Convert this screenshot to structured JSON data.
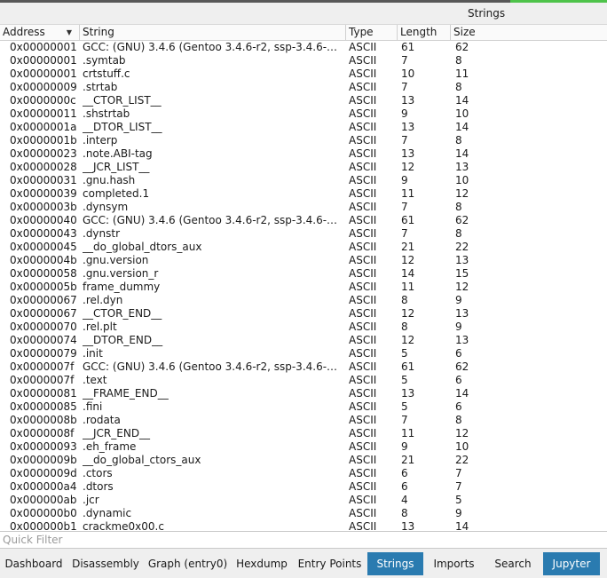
{
  "panel": {
    "title": "Strings"
  },
  "table": {
    "columns": {
      "address": "Address",
      "string": "String",
      "type": "Type",
      "length": "Length",
      "size": "Size"
    },
    "rows": [
      [
        "0x00000001",
        "GCC: (GNU) 3.4.6 (Gentoo 3.4.6-r2, ssp-3.4.6-…",
        "ASCII",
        "61",
        "62"
      ],
      [
        "0x00000001",
        ".symtab",
        "ASCII",
        "7",
        "8"
      ],
      [
        "0x00000001",
        "crtstuff.c",
        "ASCII",
        "10",
        "11"
      ],
      [
        "0x00000009",
        ".strtab",
        "ASCII",
        "7",
        "8"
      ],
      [
        "0x0000000c",
        "__CTOR_LIST__",
        "ASCII",
        "13",
        "14"
      ],
      [
        "0x00000011",
        ".shstrtab",
        "ASCII",
        "9",
        "10"
      ],
      [
        "0x0000001a",
        "__DTOR_LIST__",
        "ASCII",
        "13",
        "14"
      ],
      [
        "0x0000001b",
        ".interp",
        "ASCII",
        "7",
        "8"
      ],
      [
        "0x00000023",
        ".note.ABI-tag",
        "ASCII",
        "13",
        "14"
      ],
      [
        "0x00000028",
        "__JCR_LIST__",
        "ASCII",
        "12",
        "13"
      ],
      [
        "0x00000031",
        ".gnu.hash",
        "ASCII",
        "9",
        "10"
      ],
      [
        "0x00000039",
        "completed.1",
        "ASCII",
        "11",
        "12"
      ],
      [
        "0x0000003b",
        ".dynsym",
        "ASCII",
        "7",
        "8"
      ],
      [
        "0x00000040",
        "GCC: (GNU) 3.4.6 (Gentoo 3.4.6-r2, ssp-3.4.6-…",
        "ASCII",
        "61",
        "62"
      ],
      [
        "0x00000043",
        ".dynstr",
        "ASCII",
        "7",
        "8"
      ],
      [
        "0x00000045",
        "__do_global_dtors_aux",
        "ASCII",
        "21",
        "22"
      ],
      [
        "0x0000004b",
        ".gnu.version",
        "ASCII",
        "12",
        "13"
      ],
      [
        "0x00000058",
        ".gnu.version_r",
        "ASCII",
        "14",
        "15"
      ],
      [
        "0x0000005b",
        "frame_dummy",
        "ASCII",
        "11",
        "12"
      ],
      [
        "0x00000067",
        ".rel.dyn",
        "ASCII",
        "8",
        "9"
      ],
      [
        "0x00000067",
        "__CTOR_END__",
        "ASCII",
        "12",
        "13"
      ],
      [
        "0x00000070",
        ".rel.plt",
        "ASCII",
        "8",
        "9"
      ],
      [
        "0x00000074",
        "__DTOR_END__",
        "ASCII",
        "12",
        "13"
      ],
      [
        "0x00000079",
        ".init",
        "ASCII",
        "5",
        "6"
      ],
      [
        "0x0000007f",
        "GCC: (GNU) 3.4.6 (Gentoo 3.4.6-r2, ssp-3.4.6-…",
        "ASCII",
        "61",
        "62"
      ],
      [
        "0x0000007f",
        ".text",
        "ASCII",
        "5",
        "6"
      ],
      [
        "0x00000081",
        "__FRAME_END__",
        "ASCII",
        "13",
        "14"
      ],
      [
        "0x00000085",
        ".fini",
        "ASCII",
        "5",
        "6"
      ],
      [
        "0x0000008b",
        ".rodata",
        "ASCII",
        "7",
        "8"
      ],
      [
        "0x0000008f",
        "__JCR_END__",
        "ASCII",
        "11",
        "12"
      ],
      [
        "0x00000093",
        ".eh_frame",
        "ASCII",
        "9",
        "10"
      ],
      [
        "0x0000009b",
        "__do_global_ctors_aux",
        "ASCII",
        "21",
        "22"
      ],
      [
        "0x0000009d",
        ".ctors",
        "ASCII",
        "6",
        "7"
      ],
      [
        "0x000000a4",
        ".dtors",
        "ASCII",
        "6",
        "7"
      ],
      [
        "0x000000ab",
        ".jcr",
        "ASCII",
        "4",
        "5"
      ],
      [
        "0x000000b0",
        ".dynamic",
        "ASCII",
        "8",
        "9"
      ],
      [
        "0x000000b1",
        "crackme0x00.c",
        "ASCII",
        "13",
        "14"
      ]
    ]
  },
  "filter": {
    "placeholder": "Quick Filter",
    "value": ""
  },
  "tabs": [
    {
      "label": "Dashboard",
      "active": false
    },
    {
      "label": "Disassembly",
      "active": false
    },
    {
      "label": "Graph (entry0)",
      "active": false
    },
    {
      "label": "Hexdump",
      "active": false
    },
    {
      "label": "Entry Points",
      "active": false
    },
    {
      "label": "Strings",
      "active": true
    },
    {
      "label": "Imports",
      "active": false
    },
    {
      "label": "Search",
      "active": false
    },
    {
      "label": "Jupyter",
      "active": true
    }
  ],
  "colors": {
    "accent": "#2a7bb0",
    "progress": "#4ec34a"
  }
}
